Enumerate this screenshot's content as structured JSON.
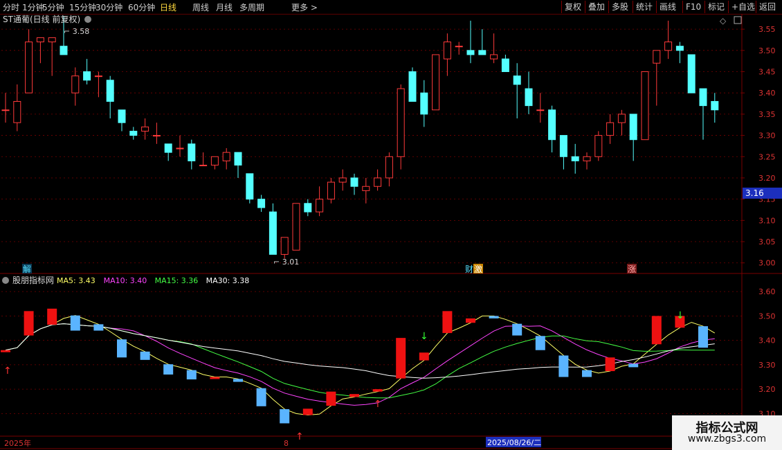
{
  "toolbar": {
    "periods": [
      "分时",
      "1分钟",
      "5分钟",
      "15分钟",
      "30分钟",
      "60分钟",
      "日线",
      "周线",
      "月线",
      "多周期",
      "更多 >"
    ],
    "active_period": "日线",
    "right_buttons": [
      "复权",
      "叠加",
      "多股",
      "统计",
      "画线",
      "F10",
      "标记",
      "+自选",
      "返回"
    ]
  },
  "main_chart": {
    "title": "ST通葡(日线 前复权)",
    "high_label": "3.58",
    "low_label": "3.01",
    "current_price": "3.16",
    "y_ticks": [
      "3.55",
      "3.50",
      "3.45",
      "3.40",
      "3.35",
      "3.30",
      "3.25",
      "3.20",
      "3.15",
      "3.10",
      "3.05",
      "3.00"
    ],
    "markers": [
      "解",
      "财",
      "激",
      "涨"
    ],
    "candles": [
      [
        3.36,
        3.4,
        3.33,
        3.36
      ],
      [
        3.33,
        3.42,
        3.31,
        3.38
      ],
      [
        3.4,
        3.55,
        3.4,
        3.52
      ],
      [
        3.52,
        3.49,
        3.47,
        3.53
      ],
      [
        3.52,
        3.53,
        3.44,
        3.53
      ],
      [
        3.51,
        3.58,
        3.49,
        3.49
      ],
      [
        3.4,
        3.46,
        3.37,
        3.44
      ],
      [
        3.45,
        3.48,
        3.42,
        3.43
      ],
      [
        3.44,
        3.45,
        3.39,
        3.44
      ],
      [
        3.43,
        3.44,
        3.34,
        3.38
      ],
      [
        3.36,
        3.35,
        3.31,
        3.33
      ],
      [
        3.31,
        3.32,
        3.29,
        3.3
      ],
      [
        3.31,
        3.34,
        3.29,
        3.32
      ],
      [
        3.3,
        3.33,
        3.28,
        3.3
      ],
      [
        3.28,
        3.28,
        3.24,
        3.26
      ],
      [
        3.27,
        3.3,
        3.25,
        3.27
      ],
      [
        3.28,
        3.29,
        3.22,
        3.24
      ],
      [
        3.23,
        3.26,
        3.23,
        3.23
      ],
      [
        3.23,
        3.24,
        3.22,
        3.25
      ],
      [
        3.24,
        3.27,
        3.22,
        3.26
      ],
      [
        3.26,
        3.24,
        3.2,
        3.23
      ],
      [
        3.21,
        3.18,
        3.14,
        3.15
      ],
      [
        3.15,
        3.16,
        3.12,
        3.13
      ],
      [
        3.12,
        3.14,
        3.02,
        3.02
      ],
      [
        3.02,
        3.06,
        3.01,
        3.06
      ],
      [
        3.03,
        3.14,
        3.03,
        3.14
      ],
      [
        3.14,
        3.15,
        3.11,
        3.12
      ],
      [
        3.12,
        3.18,
        3.11,
        3.15
      ],
      [
        3.15,
        3.2,
        3.14,
        3.19
      ],
      [
        3.19,
        3.22,
        3.17,
        3.2
      ],
      [
        3.2,
        3.21,
        3.16,
        3.18
      ],
      [
        3.17,
        3.2,
        3.14,
        3.18
      ],
      [
        3.18,
        3.22,
        3.17,
        3.2
      ],
      [
        3.2,
        3.26,
        3.18,
        3.25
      ],
      [
        3.25,
        3.42,
        3.22,
        3.41
      ],
      [
        3.45,
        3.46,
        3.38,
        3.38
      ],
      [
        3.4,
        3.43,
        3.32,
        3.35
      ],
      [
        3.36,
        3.49,
        3.36,
        3.49
      ],
      [
        3.48,
        3.54,
        3.44,
        3.52
      ],
      [
        3.51,
        3.52,
        3.49,
        3.51
      ],
      [
        3.5,
        3.57,
        3.47,
        3.49
      ],
      [
        3.5,
        3.55,
        3.49,
        3.49
      ],
      [
        3.48,
        3.54,
        3.47,
        3.49
      ],
      [
        3.48,
        3.49,
        3.45,
        3.45
      ],
      [
        3.44,
        3.47,
        3.34,
        3.42
      ],
      [
        3.41,
        3.45,
        3.35,
        3.37
      ],
      [
        3.36,
        3.4,
        3.33,
        3.36
      ],
      [
        3.36,
        3.37,
        3.26,
        3.29
      ],
      [
        3.3,
        3.3,
        3.22,
        3.25
      ],
      [
        3.25,
        3.28,
        3.21,
        3.24
      ],
      [
        3.24,
        3.26,
        3.22,
        3.25
      ],
      [
        3.25,
        3.31,
        3.24,
        3.3
      ],
      [
        3.3,
        3.35,
        3.28,
        3.33
      ],
      [
        3.33,
        3.36,
        3.3,
        3.35
      ],
      [
        3.35,
        3.29,
        3.24,
        3.29
      ],
      [
        3.29,
        3.45,
        3.29,
        3.45
      ],
      [
        3.47,
        3.5,
        3.37,
        3.5
      ],
      [
        3.5,
        3.57,
        3.48,
        3.52
      ],
      [
        3.51,
        3.52,
        3.47,
        3.5
      ],
      [
        3.49,
        3.49,
        3.4,
        3.4
      ],
      [
        3.41,
        3.4,
        3.29,
        3.37
      ],
      [
        3.38,
        3.4,
        3.33,
        3.36
      ]
    ]
  },
  "indicator": {
    "name": "股朋指标网",
    "legend": [
      {
        "label": "MA5: 3.43",
        "color": "#ffff66"
      },
      {
        "label": "MA10: 3.40",
        "color": "#ff44ff"
      },
      {
        "label": "MA15: 3.36",
        "color": "#44ff44"
      },
      {
        "label": "MA30: 3.38",
        "color": "#ffffff"
      }
    ],
    "y_ticks": [
      "3.60",
      "3.50",
      "3.40",
      "3.30",
      "3.20",
      "3.10"
    ]
  },
  "time_axis": {
    "year": "2025年",
    "month": "8",
    "cursor_date": "2025/08/26/二"
  },
  "colors": {
    "up": "#ff3a3a",
    "down": "#54ffff",
    "grid": "#7a0000",
    "bar_blue": "#5ab4ff"
  },
  "watermark": {
    "title": "指标公式网",
    "url": "www.zbgs3.com"
  }
}
